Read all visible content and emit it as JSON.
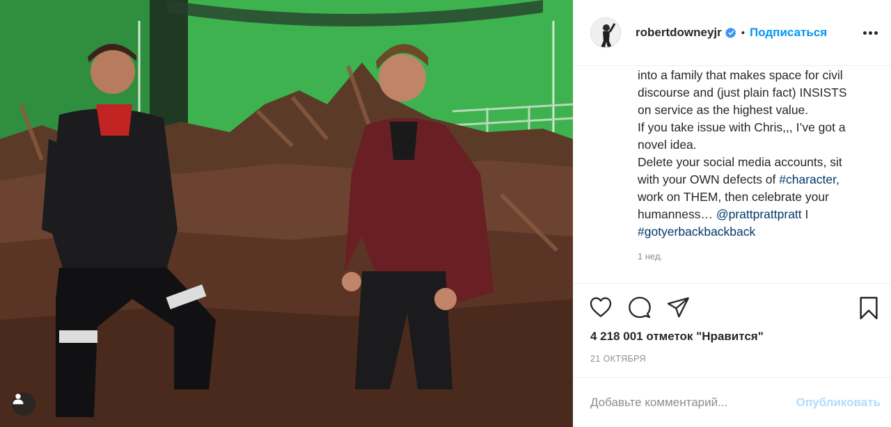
{
  "post": {
    "username": "robertdowneyjr",
    "verified": true,
    "dot": "•",
    "follow_label": "Подписаться",
    "more_icon": "more-options-icon"
  },
  "caption": {
    "line1": "into a family that makes space for civil",
    "line2": "discourse and (just plain fact) INSISTS",
    "line3": "on service as the highest value.",
    "line4": "If you take issue with Chris,,, I’ve got a",
    "line5": "novel idea.",
    "line6": "Delete your social media accounts, sit",
    "line7_text": "with your OWN defects of ",
    "line7_tag": "#character",
    "line7_end": ",",
    "line8": "work on THEM, then celebrate your",
    "line9_text": "humanness… ",
    "line9_mention": "@prattprattpratt",
    "line9_end": " I",
    "line10_tag": "#gotyerbackbackback",
    "time_ago": "1 нед."
  },
  "stats": {
    "likes": "4 218 001 отметок \"Нравится\"",
    "date": "21 ОКТЯБРЯ"
  },
  "comment": {
    "placeholder": "Добавьте комментарий...",
    "publish_label": "Опубликовать"
  },
  "colors": {
    "link": "#00376b",
    "follow": "#0095f6",
    "publish_disabled": "#b3dbff",
    "verified": "#3897f0"
  }
}
